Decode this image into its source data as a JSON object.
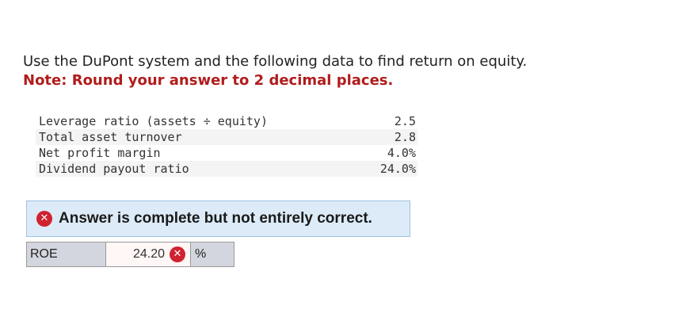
{
  "question": {
    "text": "Use the DuPont system and the following data to find return on equity.",
    "note": "Note: Round your answer to 2 decimal places."
  },
  "data_table": {
    "rows": [
      {
        "label": "Leverage ratio (assets ÷ equity)",
        "value": "2.5"
      },
      {
        "label": "Total asset turnover",
        "value": "2.8"
      },
      {
        "label": "Net profit margin",
        "value": "4.0%"
      },
      {
        "label": "Dividend payout ratio",
        "value": "24.0%"
      }
    ]
  },
  "feedback": {
    "icon": "x-circle-icon",
    "message": "Answer is complete but not entirely correct.",
    "error_color": "#d02230"
  },
  "answer": {
    "label": "ROE",
    "value": "24.20",
    "unit": "%"
  },
  "colors": {
    "note_red": "#b01c1c",
    "banner_bg": "#dcebf7",
    "label_cell_bg": "#d3d6de"
  }
}
